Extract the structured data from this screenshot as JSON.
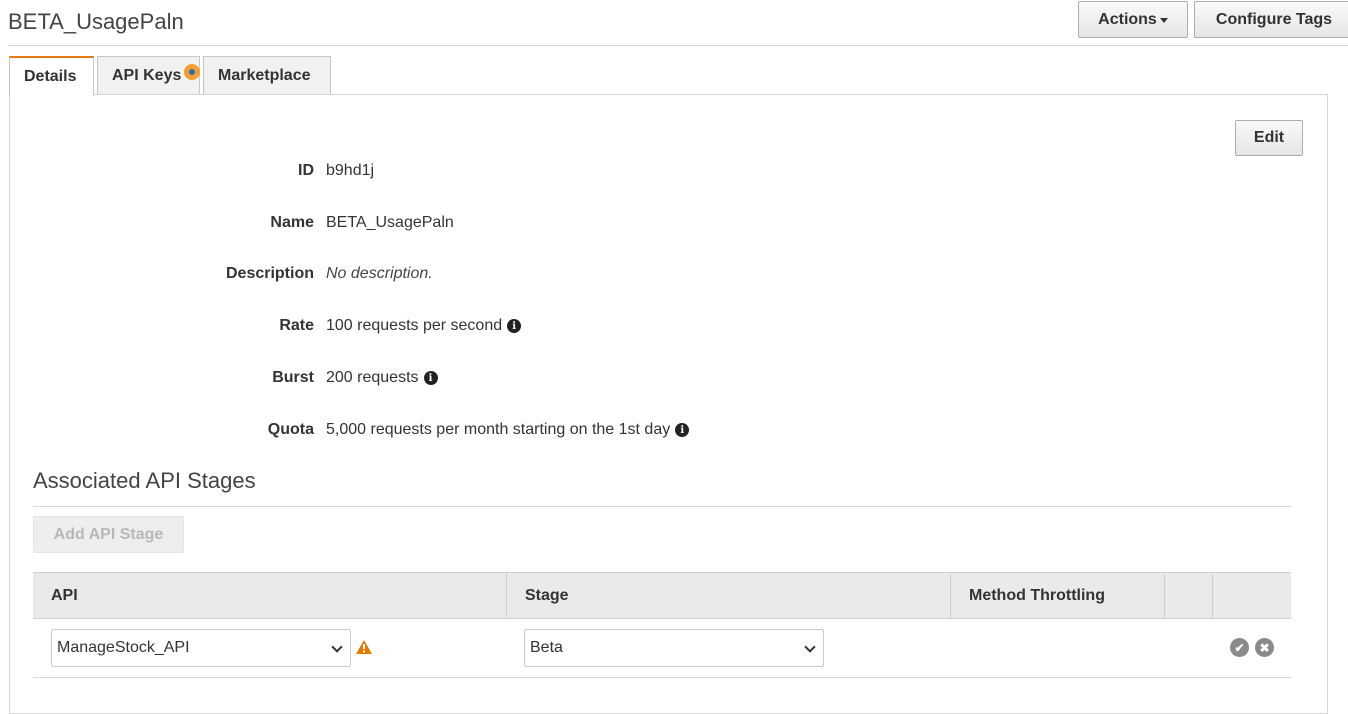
{
  "page": {
    "title": "BETA_UsagePaln"
  },
  "header": {
    "actions_label": "Actions",
    "configure_tags_label": "Configure Tags"
  },
  "tabs": [
    {
      "label": "Details",
      "active": true
    },
    {
      "label": "API Keys",
      "active": false
    },
    {
      "label": "Marketplace",
      "active": false
    }
  ],
  "details": {
    "edit_label": "Edit",
    "fields": [
      {
        "label": "ID",
        "value": "b9hd1j"
      },
      {
        "label": "Name",
        "value": "BETA_UsagePaln"
      },
      {
        "label": "Description",
        "value": "No description."
      },
      {
        "label": "Rate",
        "value": "100 requests per second"
      },
      {
        "label": "Burst",
        "value": "200 requests"
      },
      {
        "label": "Quota",
        "value": "5,000 requests per month starting on the 1st day"
      }
    ]
  },
  "stages": {
    "title": "Associated API Stages",
    "add_label": "Add API Stage",
    "columns": [
      "API",
      "Stage",
      "Method Throttling"
    ],
    "rows": [
      {
        "api": "ManageStock_API",
        "stage": "Beta"
      }
    ]
  },
  "colors": {
    "accent": "#e47911",
    "warning": "#e07b00",
    "badge": "#f0a030"
  },
  "icons": [
    "caret-down-icon",
    "info-icon",
    "warning-icon",
    "chevron-down-icon",
    "check-icon",
    "cancel-icon"
  ]
}
